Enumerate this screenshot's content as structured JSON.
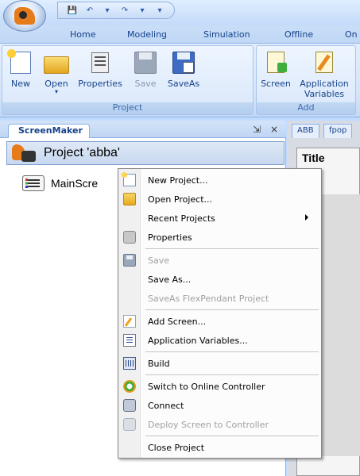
{
  "ribbon": {
    "tabs": [
      "Home",
      "Modeling",
      "Simulation",
      "Offline",
      "On"
    ],
    "project_group": {
      "label": "Project",
      "buttons": [
        {
          "label": "New"
        },
        {
          "label": "Open"
        },
        {
          "label": "Properties"
        },
        {
          "label": "Save"
        },
        {
          "label": "SaveAs"
        }
      ]
    },
    "add_group": {
      "label": "Add",
      "buttons": [
        {
          "label": "Screen"
        },
        {
          "label": "Application Variables"
        }
      ]
    }
  },
  "panel": {
    "tab_label": "ScreenMaker",
    "pin_glyph": "⇲",
    "close_glyph": "×",
    "project_title": "Project 'abba'",
    "tree_item": "MainScre"
  },
  "doc": {
    "tabs": [
      "ABB",
      "fpop"
    ],
    "title_text": "Title"
  },
  "context_menu": {
    "items": [
      {
        "label": "New Project...",
        "icon": "new-document-icon",
        "enabled": true
      },
      {
        "label": "Open Project...",
        "icon": "open-folder-icon",
        "enabled": true
      },
      {
        "label": "Recent Projects",
        "icon": "",
        "enabled": true,
        "submenu": true
      },
      {
        "label": "Properties",
        "icon": "properties-icon",
        "enabled": true
      },
      {
        "label": "Save",
        "icon": "save-icon",
        "enabled": false
      },
      {
        "label": "Save As...",
        "icon": "",
        "enabled": true
      },
      {
        "label": "SaveAs FlexPendant Project",
        "icon": "",
        "enabled": false
      },
      {
        "label": "Add Screen...",
        "icon": "add-screen-icon",
        "enabled": true
      },
      {
        "label": "Application Variables...",
        "icon": "application-variables-icon",
        "enabled": true
      },
      {
        "label": "Build",
        "icon": "build-icon",
        "enabled": true
      },
      {
        "label": "Switch to Online Controller",
        "icon": "switch-controller-icon",
        "enabled": true
      },
      {
        "label": "Connect",
        "icon": "connect-icon",
        "enabled": true
      },
      {
        "label": "Deploy Screen to Controller",
        "icon": "deploy-icon",
        "enabled": false
      },
      {
        "label": "Close Project",
        "icon": "",
        "enabled": true
      }
    ]
  },
  "colors": {
    "ribbon_text": "#15428b",
    "disabled_text": "#a0a0a0",
    "menu_bg": "#fcfcfc"
  }
}
